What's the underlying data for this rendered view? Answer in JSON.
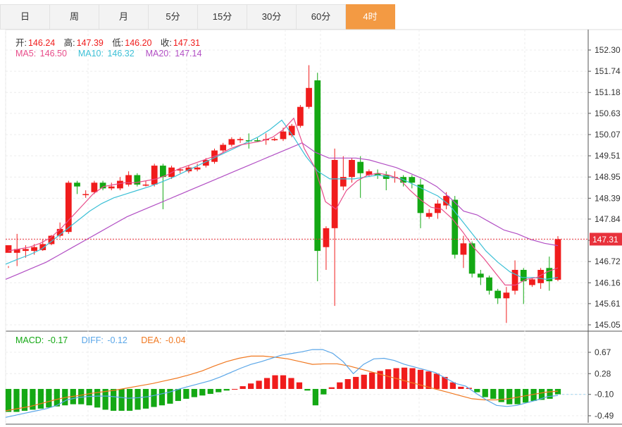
{
  "tabs": [
    {
      "label": "日"
    },
    {
      "label": "周"
    },
    {
      "label": "月"
    },
    {
      "label": "5分"
    },
    {
      "label": "15分"
    },
    {
      "label": "30分"
    },
    {
      "label": "60分"
    },
    {
      "label": "4时",
      "active": true
    }
  ],
  "ohlc_legend": {
    "open_label": "开:",
    "open": "146.24",
    "high_label": "高:",
    "high": "147.39",
    "low_label": "低:",
    "low": "146.20",
    "close_label": "收:",
    "close": "147.31"
  },
  "ma_legend": {
    "ma5_label": "MA5:",
    "ma5": "146.50",
    "ma10_label": "MA10:",
    "ma10": "146.32",
    "ma20_label": "MA20:",
    "ma20": "147.14"
  },
  "macd_legend": {
    "macd_label": "MACD:",
    "macd": "-0.17",
    "diff_label": "DIFF:",
    "diff": "-0.12",
    "dea_label": "DEA:",
    "dea": "-0.04"
  },
  "colors": {
    "up": "#f01c1c",
    "down": "#14a814",
    "ma5": "#e84d8a",
    "ma10": "#3cc0d6",
    "ma20": "#b24fc4",
    "diff": "#5aa6e8",
    "dea": "#f07820",
    "price_tag": "#e8323c"
  },
  "chart_data": {
    "type": "candlestick",
    "price_axis": {
      "ticks": [
        152.3,
        151.74,
        151.18,
        150.63,
        150.07,
        149.51,
        148.95,
        148.39,
        147.84,
        147.28,
        146.72,
        146.16,
        145.61,
        145.05
      ],
      "tick_labels": [
        "152.30",
        "151.74",
        "151.18",
        "150.63",
        "150.07",
        "149.51",
        "148.95",
        "148.39",
        "147.84",
        "",
        "146.72",
        "146.16",
        "145.61",
        "145.05"
      ],
      "current_price": 147.31,
      "current_label": "147.31"
    },
    "macd_axis": {
      "ticks": [
        0.67,
        0.28,
        -0.1,
        -0.49
      ],
      "tick_labels": [
        "0.67",
        "0.28",
        "-0.10",
        "-0.49"
      ]
    },
    "candles": [
      [
        146.95,
        147.15,
        146.6,
        146.55
      ],
      [
        146.95,
        147.05,
        147.45,
        146.6
      ],
      [
        147.0,
        147.05,
        147.15,
        146.82
      ],
      [
        147.0,
        147.1,
        147.18,
        146.9
      ],
      [
        147.02,
        147.18,
        147.3,
        147.0
      ],
      [
        147.18,
        147.4,
        147.42,
        147.15
      ],
      [
        147.4,
        147.58,
        147.75,
        147.35
      ],
      [
        147.5,
        148.8,
        148.85,
        147.45
      ],
      [
        148.8,
        148.7,
        148.85,
        148.5
      ],
      [
        148.5,
        148.5,
        148.6,
        148.4
      ],
      [
        148.55,
        148.8,
        148.85,
        148.5
      ],
      [
        148.8,
        148.65,
        148.85,
        148.6
      ],
      [
        148.65,
        148.7,
        148.8,
        148.6
      ],
      [
        148.65,
        148.85,
        148.95,
        148.6
      ],
      [
        148.75,
        149.0,
        149.1,
        148.7
      ],
      [
        149.0,
        148.75,
        149.05,
        148.7
      ],
      [
        148.75,
        148.75,
        148.85,
        148.7
      ],
      [
        148.75,
        149.25,
        149.3,
        148.7
      ],
      [
        149.25,
        148.95,
        149.3,
        148.1
      ],
      [
        148.95,
        149.2,
        149.25,
        148.9
      ],
      [
        149.15,
        149.15,
        149.2,
        149.05
      ],
      [
        149.1,
        149.2,
        149.25,
        149.05
      ],
      [
        149.15,
        149.2,
        149.3,
        149.1
      ],
      [
        149.25,
        149.4,
        149.45,
        149.2
      ],
      [
        149.35,
        149.65,
        149.7,
        149.3
      ],
      [
        149.65,
        149.8,
        149.85,
        149.6
      ],
      [
        149.8,
        149.95,
        150.0,
        149.75
      ],
      [
        149.92,
        149.95,
        150.0,
        149.85
      ],
      [
        149.92,
        149.9,
        150.1,
        149.7
      ],
      [
        149.92,
        149.9,
        149.98,
        149.88
      ],
      [
        149.92,
        149.95,
        150.1,
        149.8
      ],
      [
        149.92,
        149.95,
        150.0,
        149.9
      ],
      [
        149.95,
        150.15,
        150.25,
        149.9
      ],
      [
        150.05,
        150.3,
        150.35,
        150.0
      ],
      [
        150.3,
        150.8,
        150.85,
        150.25
      ],
      [
        150.8,
        151.3,
        151.9,
        150.75
      ],
      [
        151.5,
        147.0,
        151.7,
        146.2
      ],
      [
        147.1,
        147.6,
        147.65,
        146.5
      ],
      [
        147.6,
        149.4,
        149.7,
        145.55
      ],
      [
        148.7,
        148.95,
        149.5,
        148.6
      ],
      [
        148.95,
        149.4,
        149.45,
        148.8
      ],
      [
        149.35,
        149.05,
        149.5,
        148.4
      ],
      [
        149.0,
        149.1,
        149.15,
        148.95
      ],
      [
        149.05,
        149.0,
        149.15,
        148.9
      ],
      [
        149.0,
        148.9,
        149.1,
        148.6
      ],
      [
        148.95,
        148.95,
        149.1,
        148.8
      ],
      [
        148.95,
        148.8,
        149.0,
        148.7
      ],
      [
        148.95,
        148.8,
        149.0,
        148.65
      ],
      [
        148.75,
        148.0,
        148.9,
        147.6
      ],
      [
        147.9,
        148.0,
        148.1,
        147.85
      ],
      [
        148.0,
        148.25,
        148.35,
        147.85
      ],
      [
        148.2,
        148.45,
        148.55,
        148.1
      ],
      [
        148.35,
        146.9,
        148.45,
        146.8
      ],
      [
        146.9,
        147.2,
        147.4,
        146.55
      ],
      [
        147.2,
        146.4,
        147.25,
        146.3
      ],
      [
        146.4,
        146.3,
        146.5,
        146.1
      ],
      [
        146.3,
        145.95,
        146.35,
        145.85
      ],
      [
        145.95,
        145.75,
        146.0,
        145.6
      ],
      [
        145.75,
        145.9,
        146.05,
        145.1
      ],
      [
        145.95,
        146.5,
        146.75,
        145.85
      ],
      [
        146.5,
        146.2,
        146.55,
        145.6
      ],
      [
        146.1,
        146.25,
        146.3,
        146.05
      ],
      [
        146.15,
        146.5,
        146.55,
        146.0
      ],
      [
        146.55,
        146.2,
        146.85,
        145.95
      ],
      [
        146.24,
        147.31,
        147.39,
        146.2
      ]
    ],
    "ma5": [
      147.0,
      147.05,
      147.1,
      147.2,
      147.35,
      147.6,
      147.9,
      148.2,
      148.5,
      148.7,
      148.75,
      148.8,
      148.8,
      148.85,
      148.9,
      149.0,
      149.15,
      149.25,
      149.35,
      149.45,
      149.55,
      149.7,
      149.8,
      149.85,
      149.9,
      150.0,
      150.2,
      150.5,
      149.7,
      149.2,
      148.3,
      148.1,
      148.6,
      148.85,
      149.0,
      149.05,
      149.0,
      148.9,
      148.6,
      148.35,
      148.15,
      148.1,
      147.85,
      147.5,
      147.1,
      146.8,
      146.45,
      146.1,
      146.1,
      146.25,
      146.3,
      146.45,
      146.55
    ],
    "ma10": [
      146.65,
      146.78,
      146.9,
      147.05,
      147.3,
      147.55,
      147.8,
      148.05,
      148.25,
      148.4,
      148.5,
      148.6,
      148.7,
      148.82,
      148.95,
      149.1,
      149.25,
      149.4,
      149.55,
      149.7,
      149.85,
      150.0,
      150.2,
      150.45,
      150.0,
      149.5,
      149.1,
      148.9,
      148.9,
      148.9,
      148.95,
      149.0,
      148.95,
      148.9,
      148.75,
      148.6,
      148.45,
      148.2,
      147.8,
      147.4,
      147.0,
      146.7,
      146.45,
      146.3,
      146.3,
      146.25,
      146.3
    ],
    "ma20": [
      146.25,
      146.4,
      146.55,
      146.7,
      146.9,
      147.1,
      147.3,
      147.5,
      147.7,
      147.9,
      148.05,
      148.2,
      148.35,
      148.5,
      148.65,
      148.8,
      148.95,
      149.1,
      149.25,
      149.4,
      149.55,
      149.7,
      149.85,
      149.6,
      149.45,
      149.45,
      149.45,
      149.4,
      149.3,
      149.2,
      149.05,
      148.9,
      148.7,
      148.4,
      148.05,
      147.95,
      147.75,
      147.55,
      147.45,
      147.3,
      147.2,
      147.14
    ],
    "macd_hist": [
      -0.42,
      -0.42,
      -0.4,
      -0.38,
      -0.36,
      -0.34,
      -0.32,
      -0.3,
      -0.28,
      -0.28,
      -0.3,
      -0.34,
      -0.38,
      -0.4,
      -0.4,
      -0.4,
      -0.38,
      -0.36,
      -0.33,
      -0.3,
      -0.27,
      -0.22,
      -0.18,
      -0.15,
      -0.12,
      -0.09,
      -0.06,
      -0.03,
      0.0,
      0.05,
      0.1,
      0.15,
      0.2,
      0.25,
      0.25,
      0.2,
      0.12,
      -0.03,
      -0.3,
      -0.1,
      0.03,
      0.12,
      0.18,
      0.22,
      0.26,
      0.3,
      0.33,
      0.36,
      0.38,
      0.39,
      0.38,
      0.35,
      0.32,
      0.28,
      0.22,
      0.12,
      0.04,
      0.02,
      -0.06,
      -0.15,
      -0.18,
      -0.24,
      -0.28,
      -0.28,
      -0.25,
      -0.22,
      -0.2,
      -0.18,
      -0.1
    ],
    "diff": [
      -0.52,
      -0.48,
      -0.44,
      -0.4,
      -0.36,
      -0.3,
      -0.2,
      -0.16,
      -0.14,
      -0.13,
      -0.13,
      -0.15,
      -0.17,
      -0.16,
      -0.14,
      -0.1,
      -0.06,
      0.0,
      0.05,
      0.1,
      0.15,
      0.22,
      0.3,
      0.38,
      0.45,
      0.5,
      0.56,
      0.62,
      0.65,
      0.68,
      0.72,
      0.72,
      0.65,
      0.5,
      0.28,
      0.45,
      0.55,
      0.56,
      0.52,
      0.45,
      0.4,
      0.35,
      0.3,
      0.2,
      0.1,
      0.05,
      -0.08,
      -0.2,
      -0.3,
      -0.32,
      -0.3,
      -0.25,
      -0.2,
      -0.14,
      -0.12
    ],
    "dea": [
      -0.4,
      -0.36,
      -0.32,
      -0.26,
      -0.2,
      -0.15,
      -0.12,
      -0.08,
      -0.05,
      -0.02,
      0.02,
      0.06,
      0.1,
      0.15,
      0.2,
      0.26,
      0.33,
      0.42,
      0.5,
      0.56,
      0.6,
      0.6,
      0.58,
      0.55,
      0.5,
      0.45,
      0.46,
      0.46,
      0.42,
      0.36,
      0.3,
      0.24,
      0.18,
      0.12,
      0.06,
      0.0,
      -0.06,
      -0.12,
      -0.18,
      -0.2,
      -0.2,
      -0.18,
      -0.14,
      -0.1,
      -0.06,
      -0.04
    ]
  }
}
